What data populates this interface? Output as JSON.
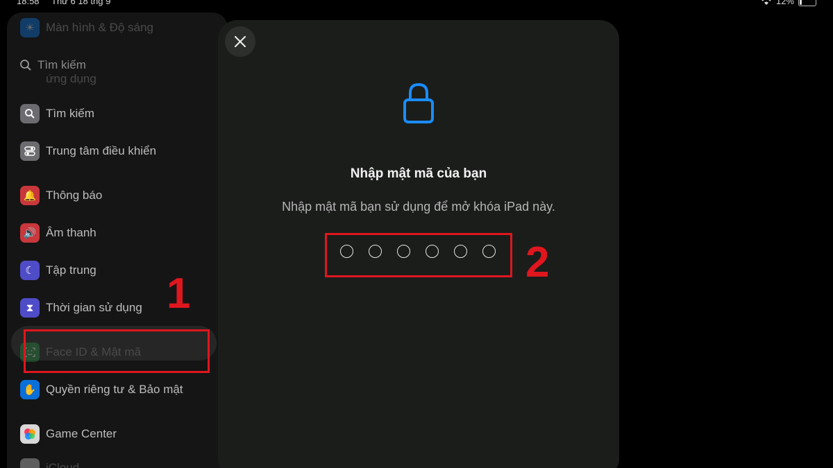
{
  "status_bar": {
    "time": "18:58",
    "date": "Thứ 6 18 thg 9",
    "battery": "12%",
    "wifi_icon": "wifi-icon",
    "battery_icon": "battery-icon"
  },
  "sidebar": {
    "partial_top": "Màn hình & Độ sáng",
    "search_placeholder": "Tìm kiếm",
    "partial_under_search": "ứng dụng",
    "items": [
      {
        "label": "Tìm kiếm",
        "icon": "search-icon",
        "color": "#8e8e93"
      },
      {
        "label": "Trung tâm điều khiển",
        "icon": "toggles-icon",
        "color": "#8e8e93"
      },
      {
        "label": "Thông báo",
        "icon": "bell-icon",
        "color": "#e5484d"
      },
      {
        "label": "Âm thanh",
        "icon": "speaker-icon",
        "color": "#e5484d"
      },
      {
        "label": "Tập trung",
        "icon": "moon-icon",
        "color": "#5e5ce6"
      },
      {
        "label": "Thời gian sử dụng",
        "icon": "hourglass-icon",
        "color": "#5e5ce6"
      },
      {
        "label": "Face ID & Mật mã",
        "icon": "face-id-icon",
        "color": "#34c759"
      },
      {
        "label": "Quyền riêng tư & Bảo mật",
        "icon": "hand-icon",
        "color": "#0a84ff"
      },
      {
        "label": "Game Center",
        "icon": "game-center-icon",
        "color": "#ff375f"
      },
      {
        "label": "iCloud",
        "icon": "icloud-icon",
        "color": "#ffffff"
      }
    ]
  },
  "modal": {
    "close_icon": "close-icon",
    "lock_icon": "lock-icon",
    "title": "Nhập mật mã của bạn",
    "subtitle": "Nhập mật mã bạn sử dụng để mở khóa iPad này.",
    "passcode_length": 6
  },
  "annotations": {
    "label_1": "1",
    "label_2": "2",
    "color": "#e0161e"
  }
}
